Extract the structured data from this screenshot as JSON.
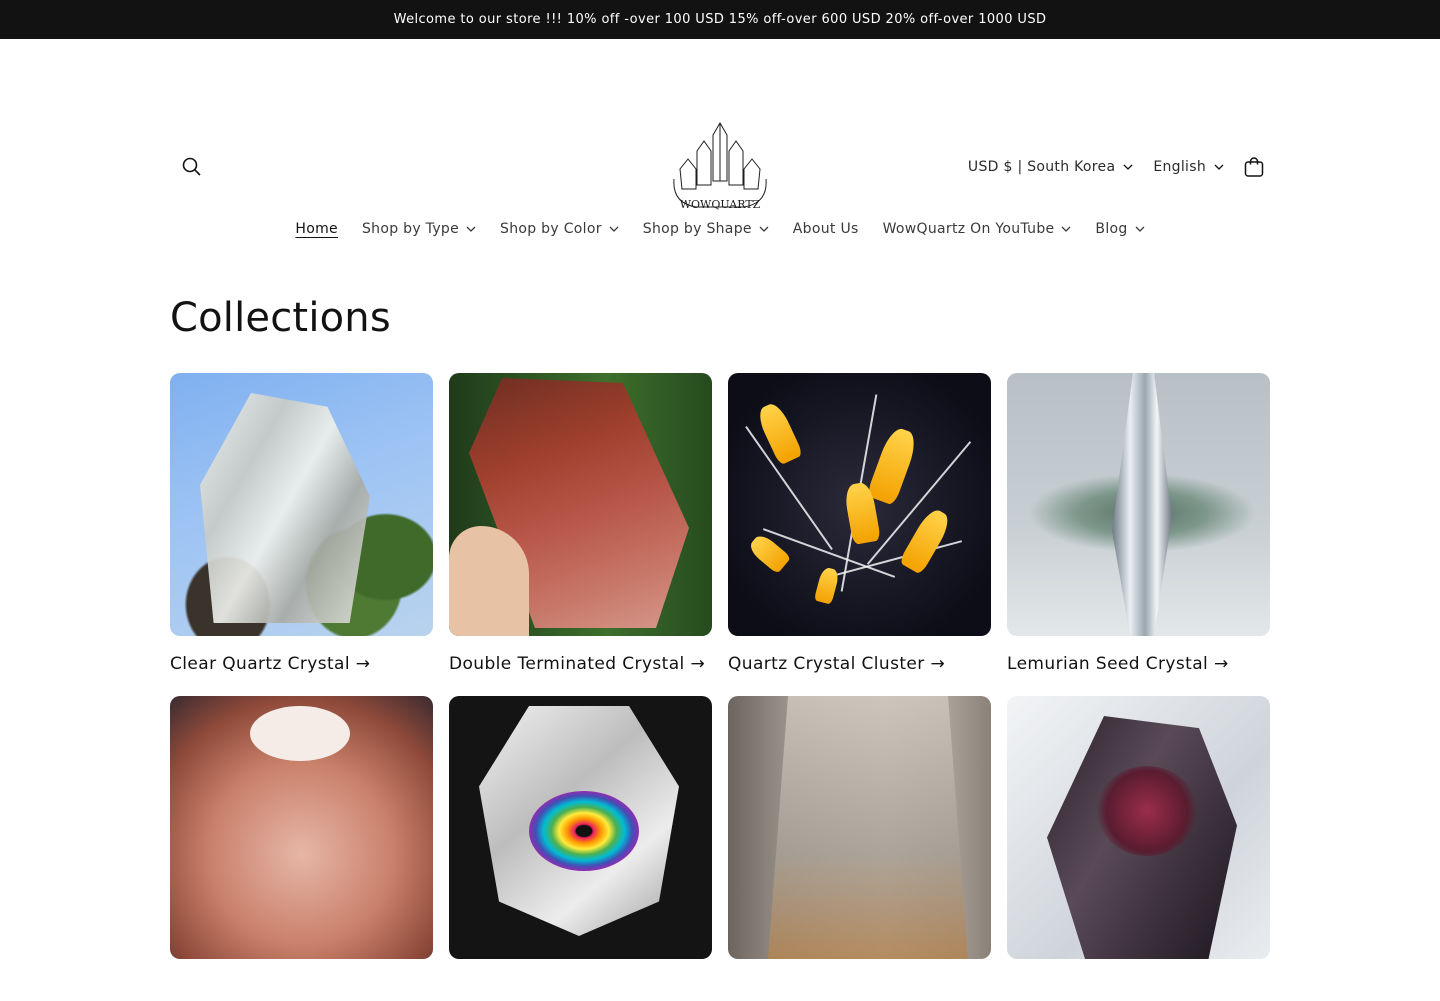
{
  "announcement": {
    "text": "Welcome to our store !!! 10% off -over 100 USD 15% off-over 600 USD 20% off-over 1000 USD"
  },
  "header": {
    "logo_text": "WOWQUARTZ",
    "search_icon": "search-icon",
    "currency_selector": "USD $ | South Korea",
    "language_selector": "English",
    "cart_icon": "cart-icon"
  },
  "nav": {
    "items": [
      {
        "label": "Home",
        "active": true,
        "has_dropdown": false
      },
      {
        "label": "Shop by Type",
        "active": false,
        "has_dropdown": true
      },
      {
        "label": "Shop by Color",
        "active": false,
        "has_dropdown": true
      },
      {
        "label": "Shop by Shape",
        "active": false,
        "has_dropdown": true
      },
      {
        "label": "About Us",
        "active": false,
        "has_dropdown": false
      },
      {
        "label": "WowQuartz On YouTube",
        "active": false,
        "has_dropdown": true
      },
      {
        "label": "Blog",
        "active": false,
        "has_dropdown": true
      }
    ]
  },
  "main": {
    "title": "Collections",
    "collections": [
      {
        "title": "Clear Quartz Crystal →"
      },
      {
        "title": "Double Terminated Crystal →"
      },
      {
        "title": "Quartz Crystal Cluster →"
      },
      {
        "title": "Lemurian Seed Crystal →"
      },
      {
        "title": ""
      },
      {
        "title": ""
      },
      {
        "title": ""
      },
      {
        "title": ""
      }
    ]
  },
  "colors": {
    "announcement_bg": "#121212",
    "text": "#121212",
    "background": "#ffffff"
  }
}
